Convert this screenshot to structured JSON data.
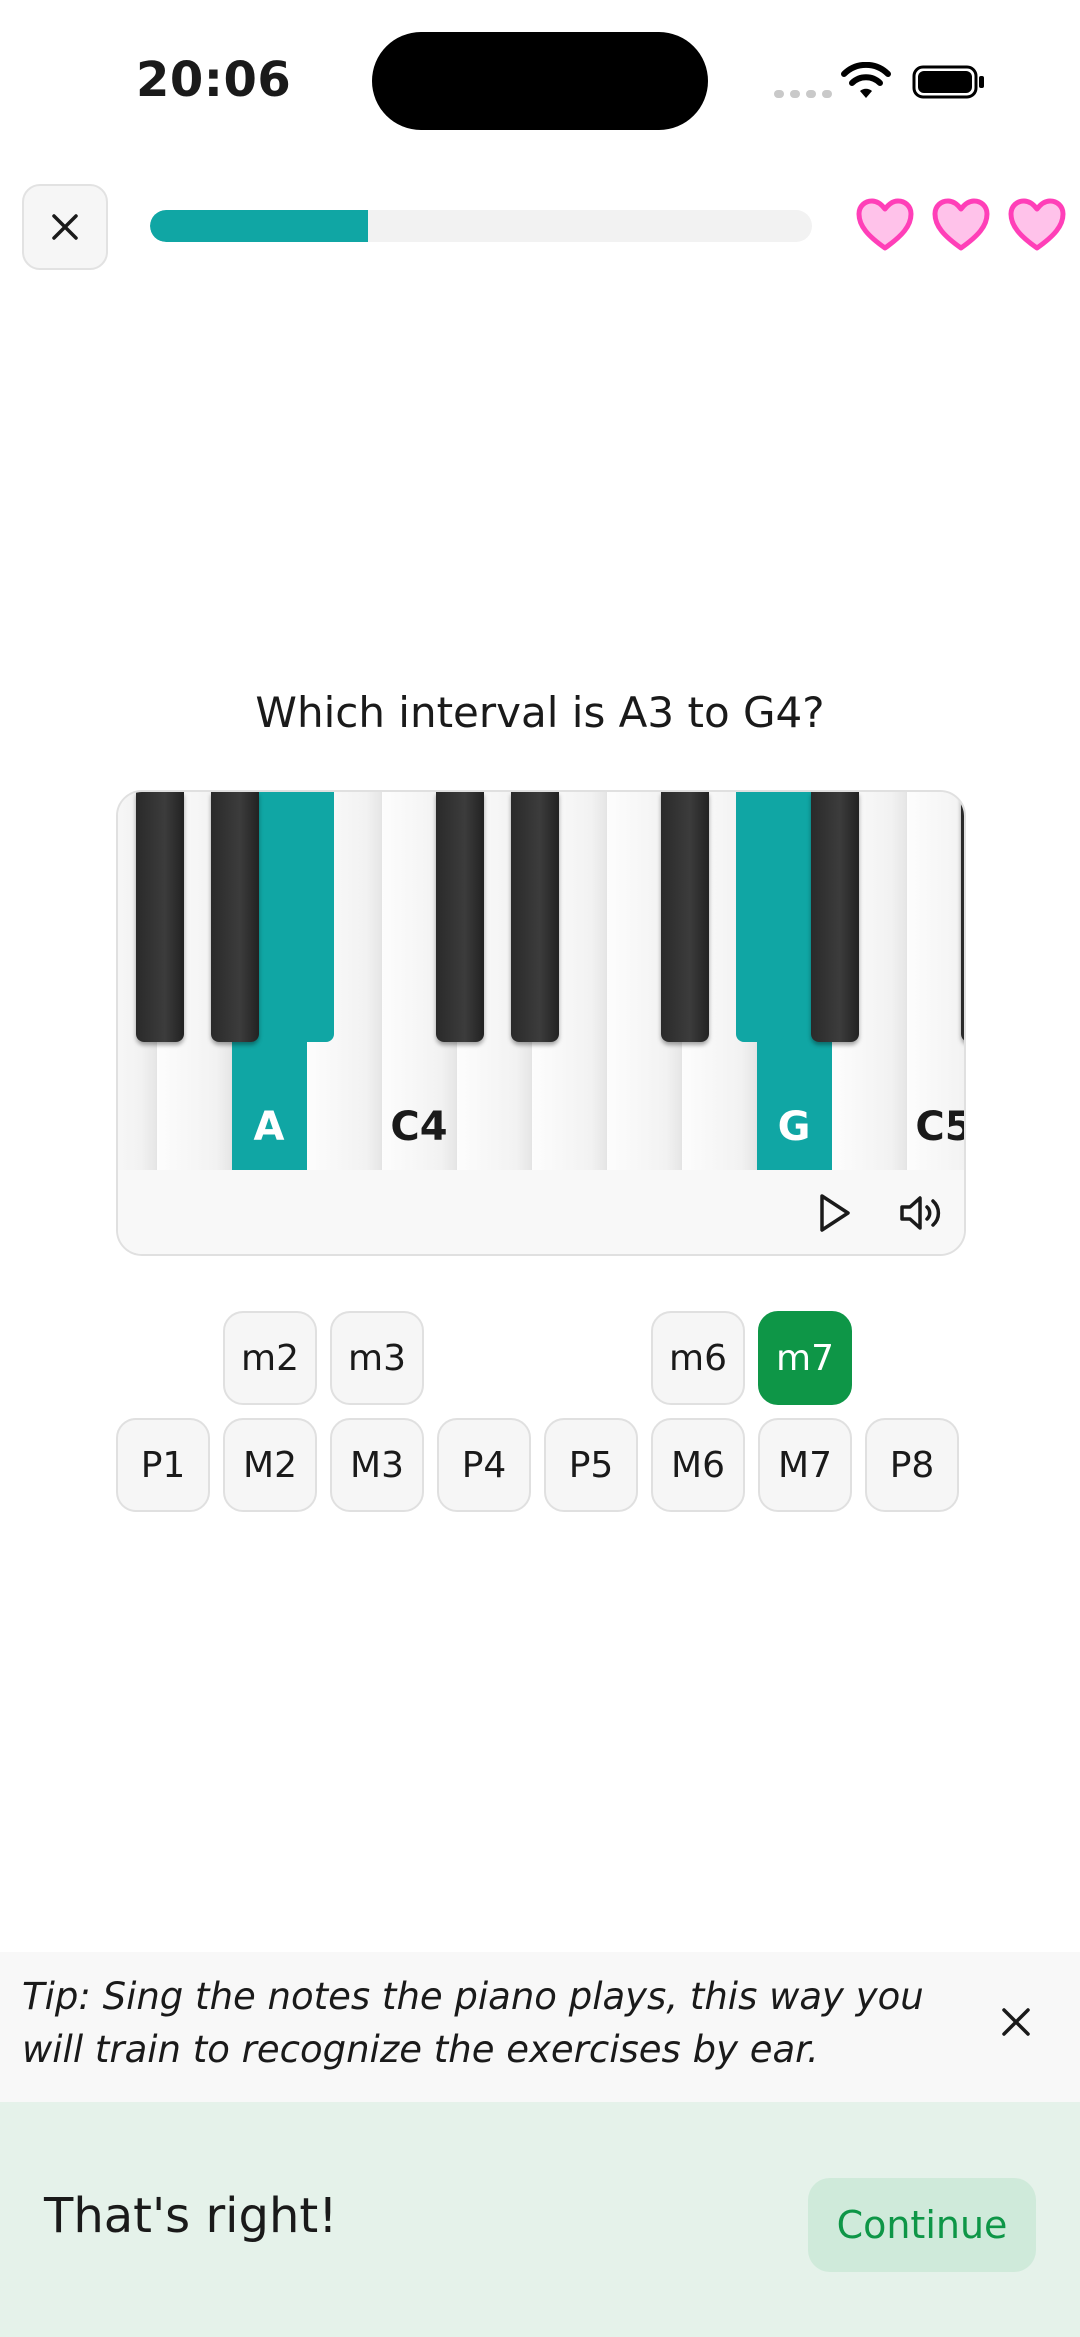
{
  "status_bar": {
    "time": "20:06"
  },
  "header": {
    "close_icon": "close-icon",
    "progress": 0.33,
    "hearts": [
      "heart-icon",
      "heart-icon",
      "heart-icon"
    ],
    "heart_color": "#ff5fbf"
  },
  "question": {
    "text": "Which interval is A3 to G4?"
  },
  "piano": {
    "white_keys": [
      {
        "label": "",
        "highlighted": false
      },
      {
        "label": "",
        "highlighted": false
      },
      {
        "label": "A",
        "highlighted": true
      },
      {
        "label": "",
        "highlighted": false
      },
      {
        "label": "C4",
        "highlighted": false
      },
      {
        "label": "",
        "highlighted": false
      },
      {
        "label": "",
        "highlighted": false
      },
      {
        "label": "",
        "highlighted": false
      },
      {
        "label": "",
        "highlighted": false
      },
      {
        "label": "G",
        "highlighted": true
      },
      {
        "label": "",
        "highlighted": false
      },
      {
        "label": "C5",
        "highlighted": false
      }
    ],
    "black_keys_highlighted": [
      false,
      false,
      true,
      false,
      false,
      false,
      true,
      false,
      false
    ],
    "accent_color": "#10a6a4",
    "play_icon": "play-icon",
    "volume_icon": "volume-icon"
  },
  "intervals": {
    "top_row": [
      {
        "label": "m2",
        "selected": false
      },
      {
        "label": "m3",
        "selected": false
      },
      {
        "label": "m6",
        "selected": false
      },
      {
        "label": "m7",
        "selected": true
      }
    ],
    "bottom_row": [
      {
        "label": "P1",
        "selected": false
      },
      {
        "label": "M2",
        "selected": false
      },
      {
        "label": "M3",
        "selected": false
      },
      {
        "label": "P4",
        "selected": false
      },
      {
        "label": "P5",
        "selected": false
      },
      {
        "label": "M6",
        "selected": false
      },
      {
        "label": "M7",
        "selected": false
      },
      {
        "label": "P8",
        "selected": false
      }
    ],
    "selected_color": "#0e9647"
  },
  "tip": {
    "text": "Tip: Sing the notes the piano plays, this way you will train to recognize the exercises by ear."
  },
  "feedback": {
    "message": "That's right!",
    "continue_label": "Continue",
    "color": "#0e9647"
  }
}
